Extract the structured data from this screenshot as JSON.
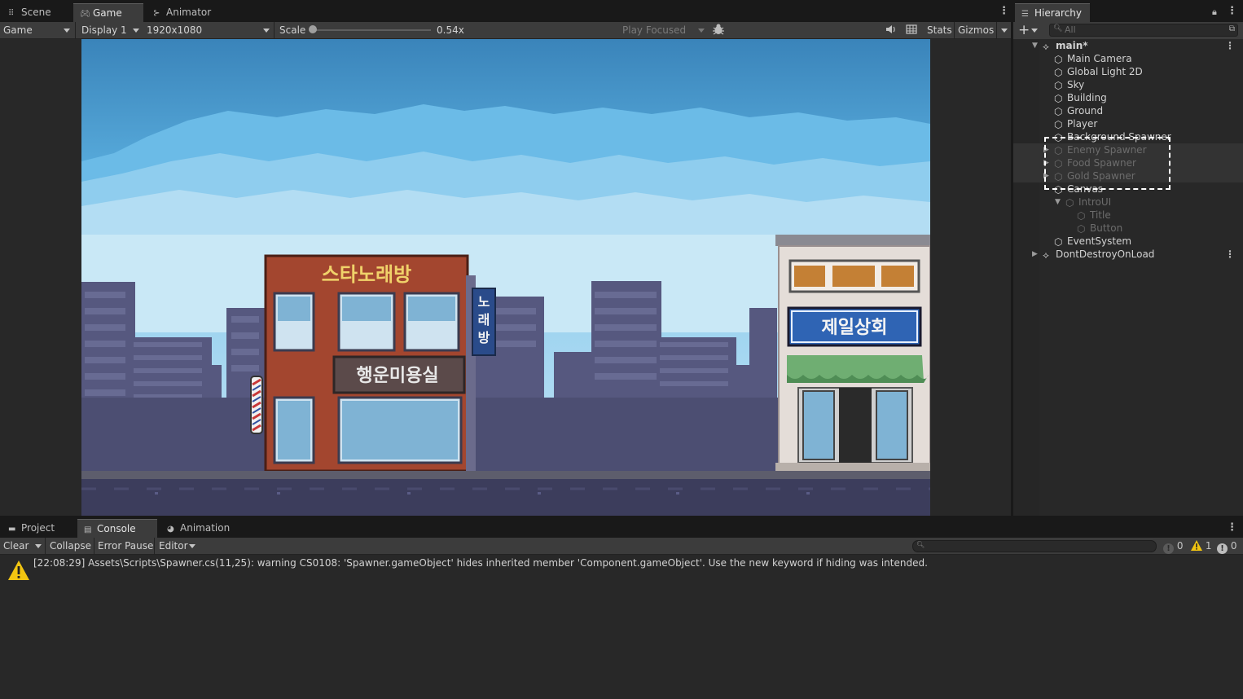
{
  "game_panel": {
    "tabs": [
      {
        "label": "Scene",
        "icon": "grid-icon"
      },
      {
        "label": "Game",
        "icon": "gamepad-icon"
      },
      {
        "label": "Animator",
        "icon": "animator-icon"
      }
    ],
    "toolbar": {
      "mode": "Game",
      "display": "Display 1",
      "resolution": "1920x1080",
      "scale_label": "Scale",
      "scale_value": "0.54x",
      "scale_fraction": 0.0,
      "play_mode": "Play Focused",
      "stats": "Stats",
      "gizmos": "Gizmos"
    },
    "game_view": {
      "left_building_sign": "스타노래방",
      "left_building_vertical_sign": "노래방",
      "left_building_lower_sign": "행운미용실",
      "right_building_sign": "제일상회"
    }
  },
  "hierarchy": {
    "tab_label": "Hierarchy",
    "search_placeholder": "All",
    "items": [
      {
        "label": "main*",
        "depth": 0,
        "expanded": true,
        "scene": true,
        "faded": false
      },
      {
        "label": "Main Camera",
        "depth": 1,
        "faded": false
      },
      {
        "label": "Global Light 2D",
        "depth": 1,
        "faded": false
      },
      {
        "label": "Sky",
        "depth": 1,
        "faded": false
      },
      {
        "label": "Building",
        "depth": 1,
        "faded": false
      },
      {
        "label": "Ground",
        "depth": 1,
        "faded": false
      },
      {
        "label": "Player",
        "depth": 1,
        "faded": false
      },
      {
        "label": "Background Spawner",
        "depth": 1,
        "faded": false
      },
      {
        "label": "Enemy Spawner",
        "depth": 1,
        "faded": true,
        "collapsed": true
      },
      {
        "label": "Food Spawner",
        "depth": 1,
        "faded": true,
        "collapsed": true
      },
      {
        "label": "Gold Spawner",
        "depth": 1,
        "faded": true,
        "collapsed": true
      },
      {
        "label": "Canvas",
        "depth": 1,
        "faded": false
      },
      {
        "label": "IntroUI",
        "depth": 2,
        "faded": true,
        "expanded": true
      },
      {
        "label": "Title",
        "depth": 3,
        "faded": true
      },
      {
        "label": "Button",
        "depth": 3,
        "faded": true
      },
      {
        "label": "EventSystem",
        "depth": 1,
        "faded": false
      },
      {
        "label": "DontDestroyOnLoad",
        "depth": 0,
        "scene": true,
        "collapsed": true,
        "faded": false
      }
    ]
  },
  "console": {
    "tabs": [
      {
        "label": "Project",
        "icon": "folder-icon"
      },
      {
        "label": "Console",
        "icon": "console-icon"
      },
      {
        "label": "Animation",
        "icon": "animation-icon"
      }
    ],
    "toolbar": {
      "clear": "Clear",
      "collapse": "Collapse",
      "error_pause": "Error Pause",
      "editor": "Editor",
      "info_count": "0",
      "warning_count": "1",
      "error_count": "0"
    },
    "logs": [
      {
        "type": "warning",
        "text": "[22:08:29] Assets\\Scripts\\Spawner.cs(11,25): warning CS0108: 'Spawner.gameObject' hides inherited member 'Component.gameObject'. Use the new keyword if hiding was intended."
      }
    ]
  },
  "colors": {
    "sky": "#3d88be",
    "warning": "#f2c511",
    "brick": "#a3462f"
  }
}
